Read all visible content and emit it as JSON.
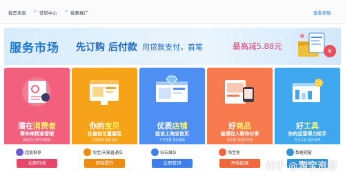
{
  "breadcrumb": {
    "items": [
      "我是卖家",
      "营销中心",
      "我要推广"
    ],
    "separator": ">",
    "help": "查看帮助"
  },
  "banner": {
    "title": "服务市场",
    "headline": "先订购 后付款",
    "subline": "用贷款支付，首笔",
    "highlight": "最高减5.88元"
  },
  "cards": [
    {
      "tag_prefix": "潜在",
      "tag_em": "消费者",
      "tag_sub": "等你来精准营销",
      "note": "精准定位潜在消费者",
      "badge": "超级推荐",
      "button": "立即行动",
      "color": "#f2607e",
      "btn_color": "#e8456b"
    },
    {
      "tag_prefix": "你的",
      "tag_em": "宝贝",
      "tag_sub": "在最佳位置展现",
      "note": "全网数据 精准投放",
      "badge": "淘宝/天猫直通车",
      "button": "即刻提升",
      "color": "#f6a31a",
      "btn_color": "#ef8c10"
    },
    {
      "tag_prefix": "优质",
      "tag_em": "店铺",
      "tag_sub": "就该上淘宝首页",
      "note": "千万流量 等你来拿",
      "badge": "钻石展位",
      "button": "立即登顶",
      "color": "#4f8ef2",
      "btn_color": "#3f7ee8"
    },
    {
      "tag_prefix": "好",
      "tag_em": "商品",
      "tag_sub": "值得找人帮你分享",
      "note": "淘宝客 按成交付费",
      "badge": "淘宝客",
      "button": "开始拓展",
      "color": "#f77b4f",
      "btn_color": "#f0663a"
    },
    {
      "tag_prefix": "好",
      "tag_em": "工具",
      "tag_sub": "你的运营得力助手",
      "note": "专业工具 提升效率",
      "badge": "数据视窗",
      "button": "即刻加入",
      "color": "#3fa7ee",
      "btn_color": "#2f93dd"
    }
  ],
  "watermark": "知乎 @淘宝资源",
  "colors": {
    "brand_blue": "#1f77d0",
    "highlight": "#e0386b"
  }
}
